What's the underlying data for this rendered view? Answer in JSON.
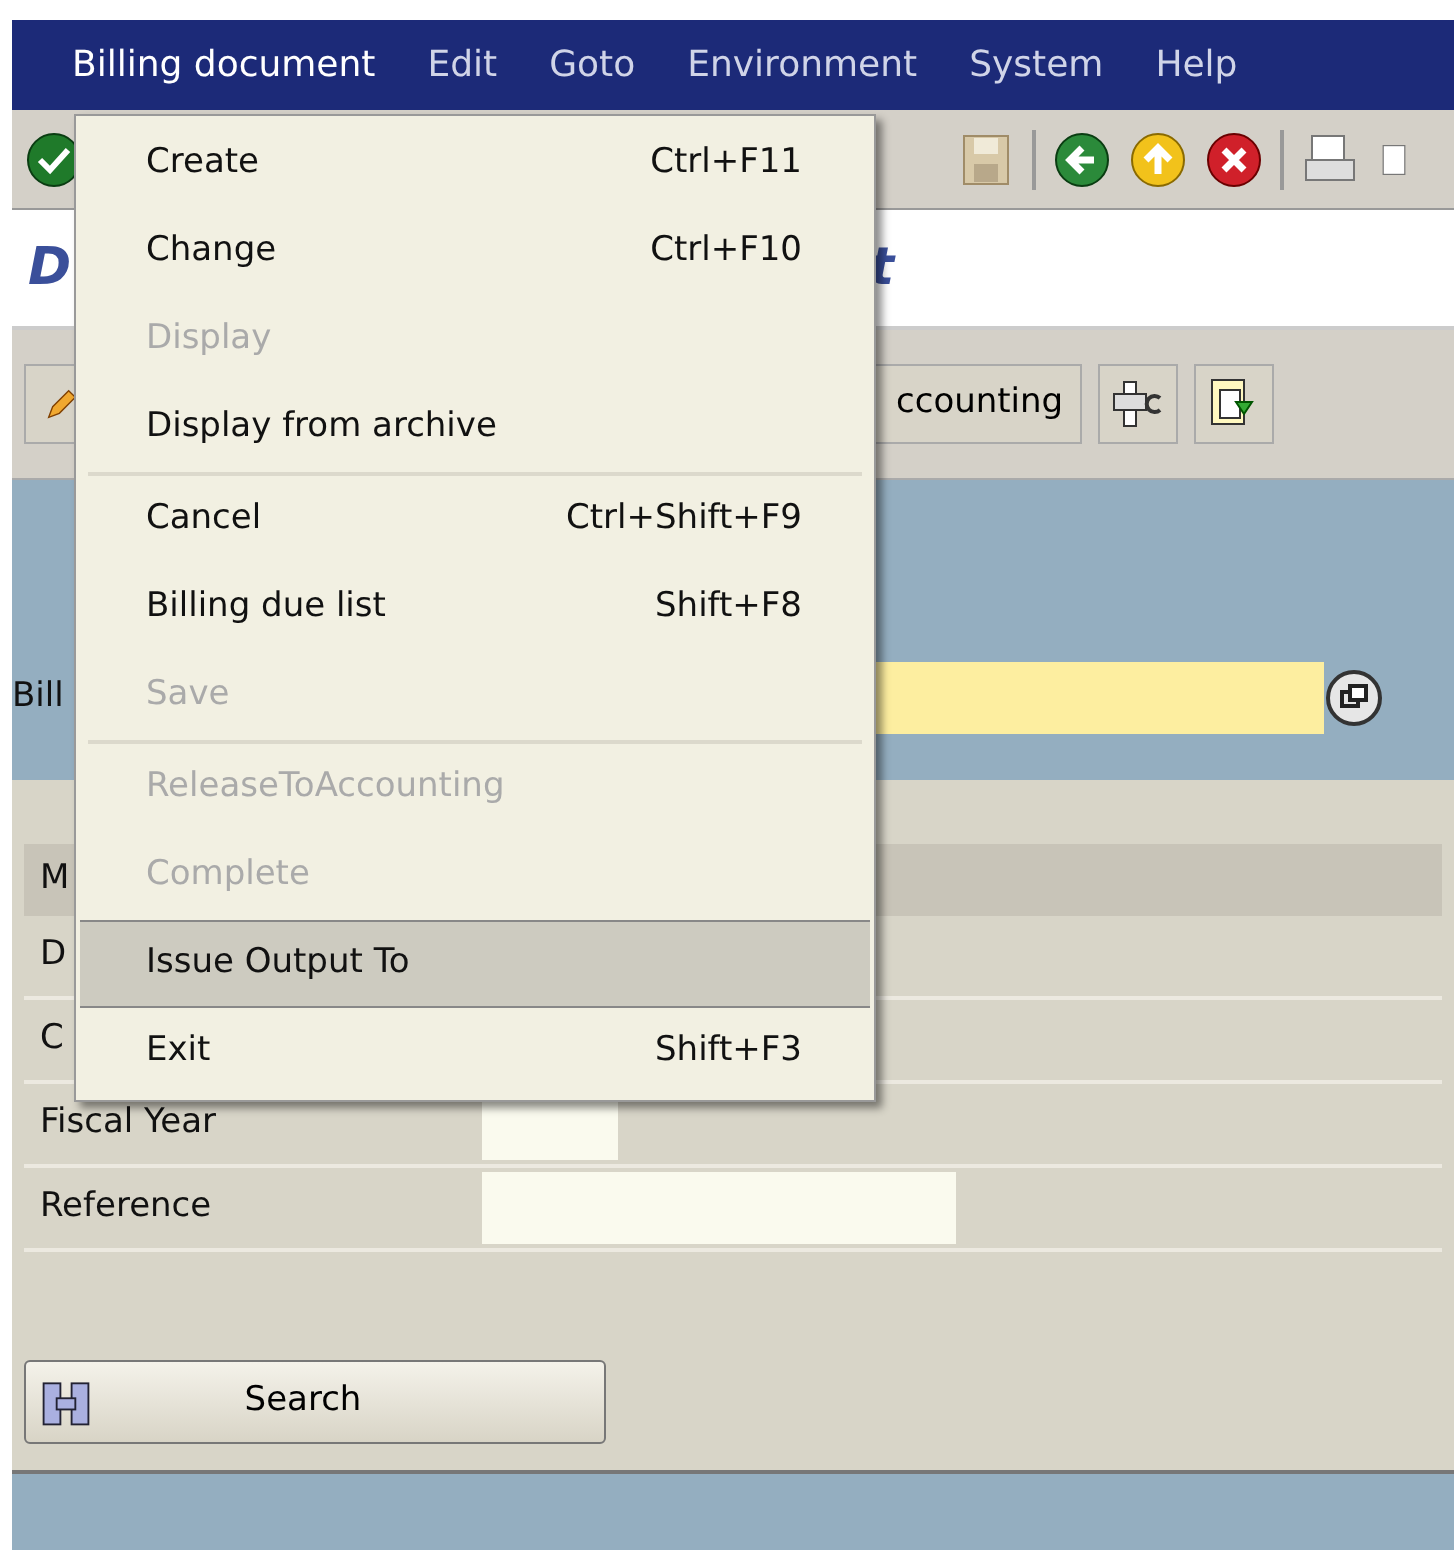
{
  "menu_bar": [
    {
      "label": "Billing document",
      "selected": true
    },
    {
      "label": "Edit",
      "selected": false
    },
    {
      "label": "Goto",
      "selected": false
    },
    {
      "label": "Environment",
      "selected": false
    },
    {
      "label": "System",
      "selected": false
    },
    {
      "label": "Help",
      "selected": false
    }
  ],
  "screen_title": {
    "visible_start": "D",
    "visible_end": "t"
  },
  "application_toolbar": {
    "button_text": "ccounting"
  },
  "selection": {
    "label": "Bill"
  },
  "table_header": "M",
  "rows": [
    {
      "label": "D",
      "kind": "plain"
    },
    {
      "label": "C",
      "kind": "plain"
    },
    {
      "label": "Fiscal Year",
      "kind": "short_field"
    },
    {
      "label": "Reference",
      "kind": "long_field"
    }
  ],
  "search_button": "Search",
  "menu": [
    {
      "label": "Create",
      "shortcut": "Ctrl+F11",
      "disabled": false,
      "selected": false,
      "separator_after": false
    },
    {
      "label": "Change",
      "shortcut": "Ctrl+F10",
      "disabled": false,
      "selected": false,
      "separator_after": false
    },
    {
      "label": "Display",
      "disabled": true,
      "selected": false,
      "separator_after": false
    },
    {
      "label": "Display from archive",
      "disabled": false,
      "selected": false,
      "separator_after": true
    },
    {
      "label": "Cancel",
      "shortcut": "Ctrl+Shift+F9",
      "disabled": false,
      "selected": false,
      "separator_after": false
    },
    {
      "label": "Billing due list",
      "shortcut": "Shift+F8",
      "disabled": false,
      "selected": false,
      "separator_after": false
    },
    {
      "label": "Save",
      "disabled": true,
      "selected": false,
      "separator_after": true
    },
    {
      "label": "ReleaseToAccounting",
      "disabled": true,
      "selected": false,
      "separator_after": false
    },
    {
      "label": "Complete",
      "disabled": true,
      "selected": false,
      "separator_after": false
    },
    {
      "label": "Issue Output To",
      "disabled": false,
      "selected": true,
      "separator_after": false
    },
    {
      "label": "Exit",
      "shortcut": "Shift+F3",
      "disabled": false,
      "selected": false,
      "separator_after": false
    }
  ]
}
